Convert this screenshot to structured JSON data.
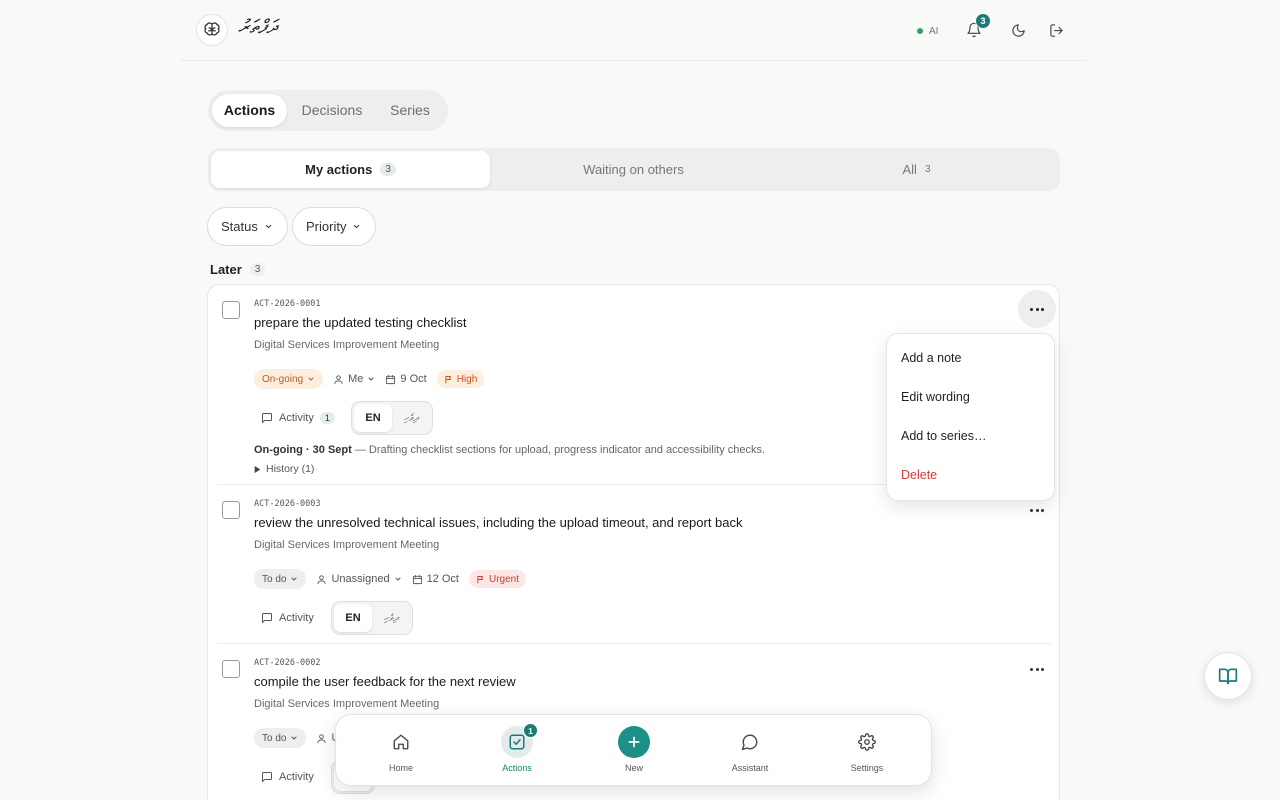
{
  "header": {
    "brand": "ދަފްތަރު",
    "ai_label": "AI",
    "notifications_count": "3"
  },
  "main_tabs": [
    {
      "label": "Actions",
      "active": true
    },
    {
      "label": "Decisions",
      "active": false
    },
    {
      "label": "Series",
      "active": false
    }
  ],
  "sub_tabs": [
    {
      "label": "My actions",
      "count": "3",
      "active": true
    },
    {
      "label": "Waiting on others",
      "count": "",
      "active": false
    },
    {
      "label": "All",
      "count": "3",
      "active": false
    }
  ],
  "filters": {
    "status_label": "Status",
    "priority_label": "Priority"
  },
  "group": {
    "title": "Later",
    "count": "3"
  },
  "actions": [
    {
      "id": "ACT-2026-0001",
      "title": "prepare the updated testing checklist",
      "meeting": "Digital Services Improvement Meeting",
      "status": "On-going",
      "assignee": "Me",
      "due": "9 Oct",
      "priority": "High",
      "activity_label": "Activity",
      "activity_count": "1",
      "lang_en": "EN",
      "lang_dv": "ދިވެހި",
      "note_prefix": "On-going · 30 Sept",
      "note_text": " — Drafting checklist sections for upload, progress indicator and accessibility checks.",
      "history_label": "History (1)"
    },
    {
      "id": "ACT-2026-0003",
      "title": "review the unresolved technical issues, including the upload timeout, and report back",
      "meeting": "Digital Services Improvement Meeting",
      "status": "To do",
      "assignee": "Unassigned",
      "due": "12 Oct",
      "priority": "Urgent",
      "activity_label": "Activity",
      "lang_en": "EN",
      "lang_dv": "ދިވެހި"
    },
    {
      "id": "ACT-2026-0002",
      "title": "compile the user feedback for the next review",
      "meeting": "Digital Services Improvement Meeting",
      "status": "To do",
      "assignee_partial": "Ur",
      "activity_label": "Activity"
    }
  ],
  "menu": {
    "items": [
      {
        "label": "Add a note"
      },
      {
        "label": "Edit wording"
      },
      {
        "label": "Add to series…"
      },
      {
        "label": "Delete"
      }
    ]
  },
  "bottom_nav": {
    "items": [
      {
        "label": "Home"
      },
      {
        "label": "Actions",
        "badge": "1"
      },
      {
        "label": "New"
      },
      {
        "label": "Assistant"
      },
      {
        "label": "Settings"
      }
    ]
  },
  "colors": {
    "accent": "#1c7b74",
    "ongoing": "#b4621d",
    "urgent": "#cc3d3a",
    "danger": "#cc3d3a"
  }
}
